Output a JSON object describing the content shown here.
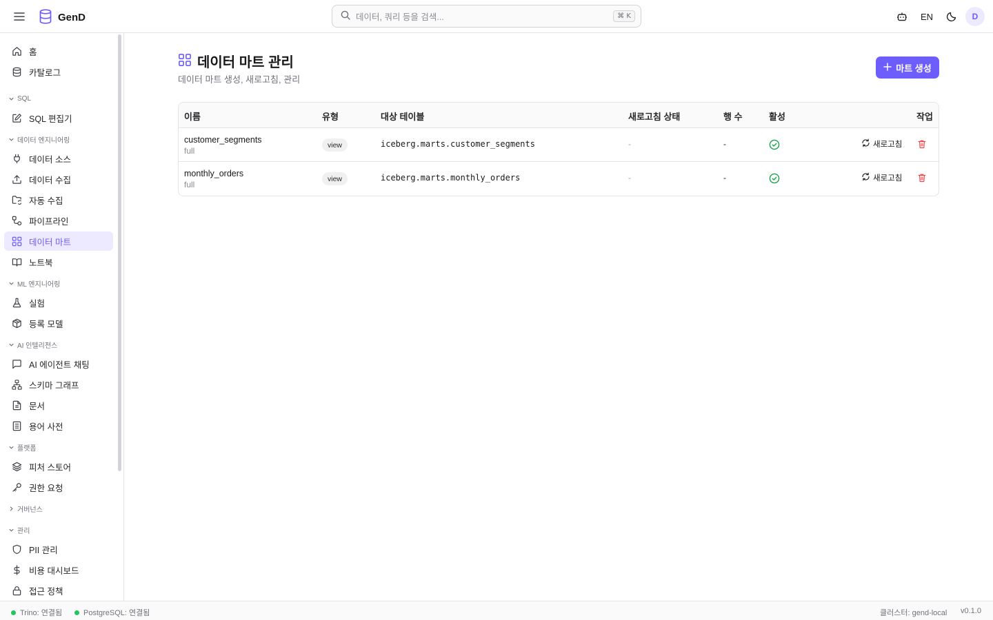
{
  "app": {
    "name": "GenD"
  },
  "search": {
    "placeholder": "데이터, 쿼리 등을 검색...",
    "shortcut": "⌘ K"
  },
  "header": {
    "lang": "EN",
    "avatar_initial": "D"
  },
  "sidebar": {
    "items_top": [
      {
        "label": "홈",
        "icon": "home-icon"
      },
      {
        "label": "카탈로그",
        "icon": "database-icon"
      }
    ],
    "sections": [
      {
        "label": "SQL",
        "expanded": true,
        "items": [
          {
            "label": "SQL 편집기",
            "icon": "edit-icon"
          }
        ]
      },
      {
        "label": "데이터 엔지니어링",
        "expanded": true,
        "items": [
          {
            "label": "데이터 소스",
            "icon": "plug-icon"
          },
          {
            "label": "데이터 수집",
            "icon": "upload-icon"
          },
          {
            "label": "자동 수집",
            "icon": "folder-sync-icon"
          },
          {
            "label": "파이프라인",
            "icon": "workflow-icon"
          },
          {
            "label": "데이터 마트",
            "icon": "grid-icon",
            "active": true
          },
          {
            "label": "노트북",
            "icon": "book-icon"
          }
        ]
      },
      {
        "label": "ML 엔지니어링",
        "expanded": true,
        "items": [
          {
            "label": "실험",
            "icon": "flask-icon"
          },
          {
            "label": "등록 모델",
            "icon": "package-icon"
          }
        ]
      },
      {
        "label": "AI 인텔리전스",
        "expanded": true,
        "items": [
          {
            "label": "AI 에이전트 채팅",
            "icon": "chat-icon"
          },
          {
            "label": "스키마 그래프",
            "icon": "network-icon"
          },
          {
            "label": "문서",
            "icon": "file-icon"
          },
          {
            "label": "용어 사전",
            "icon": "dictionary-icon"
          }
        ]
      },
      {
        "label": "플랫폼",
        "expanded": true,
        "items": [
          {
            "label": "피처 스토어",
            "icon": "layers-icon"
          },
          {
            "label": "권한 요청",
            "icon": "key-icon"
          }
        ]
      },
      {
        "label": "거버넌스",
        "expanded": false,
        "items": []
      },
      {
        "label": "관리",
        "expanded": true,
        "items": [
          {
            "label": "PII 관리",
            "icon": "shield-icon"
          },
          {
            "label": "비용 대시보드",
            "icon": "dollar-icon"
          },
          {
            "label": "접근 정책",
            "icon": "lock-icon"
          }
        ]
      }
    ]
  },
  "page": {
    "title": "데이터 마트 관리",
    "subtitle": "데이터 마트 생성, 새로고침, 관리",
    "create_button": "마트 생성"
  },
  "table": {
    "headers": {
      "name": "이름",
      "type": "유형",
      "target": "대상 테이블",
      "refresh_status": "새로고침 상태",
      "rows": "행 수",
      "active": "활성",
      "actions": "작업"
    },
    "rows": [
      {
        "name": "customer_segments",
        "mode": "full",
        "type": "view",
        "target": "iceberg.marts.customer_segments",
        "refresh_status": "-",
        "row_count": "-",
        "active": true,
        "refresh_label": "새로고침"
      },
      {
        "name": "monthly_orders",
        "mode": "full",
        "type": "view",
        "target": "iceberg.marts.monthly_orders",
        "refresh_status": "-",
        "row_count": "-",
        "active": true,
        "refresh_label": "새로고침"
      }
    ]
  },
  "footer": {
    "trino": "Trino: 연결됨",
    "postgres": "PostgreSQL: 연결됨",
    "cluster": "클러스터: gend-local",
    "version": "v0.1.0"
  },
  "colors": {
    "accent": "#6d5dfc",
    "accent_bg": "#ede9fe",
    "success": "#16a34a",
    "danger": "#ef4444"
  }
}
